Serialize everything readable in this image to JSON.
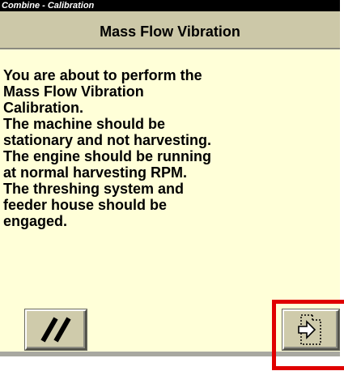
{
  "header": {
    "breadcrumb": "Combine - Calibration",
    "title": "Mass Flow Vibration"
  },
  "content": {
    "instructions": "You are about to perform the\nMass Flow Vibration\nCalibration.\nThe machine should be\nstationary and not harvesting.\nThe engine should be running\nat normal harvesting RPM.\nThe threshing system and\nfeeder house should be\nengaged."
  },
  "buttons": {
    "cancel_icon": "cancel-slashes-icon",
    "next_icon": "next-page-arrow-icon"
  },
  "colors": {
    "background": "#ffffd8",
    "title_bar": "#ccc8a8",
    "breadcrumb_bg": "#000000",
    "highlight": "#e00000"
  }
}
